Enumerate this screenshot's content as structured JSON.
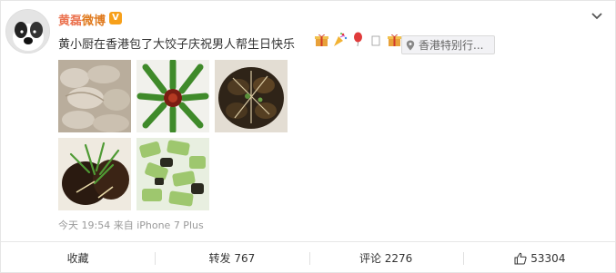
{
  "user": {
    "name_highlight": "黄磊",
    "name_rest": "微博",
    "verified_badge": "V"
  },
  "post": {
    "text": "黄小厨在香港包了大饺子庆祝男人帮生日快乐",
    "emojis": [
      "gift-icon",
      "party-popper-icon",
      "balloon-icon",
      "missing-glyph-icon",
      "gift-icon"
    ],
    "location": "香港特别行..."
  },
  "meta": {
    "time_source": "今天 19:54 来自 iPhone 7 Plus"
  },
  "actions": {
    "favorite": "收藏",
    "repost": "转发 767",
    "comment": "评论 2276",
    "like": "53304"
  },
  "colors": {
    "name_highlight": "#eb7350",
    "name_rest": "#e07a1e",
    "badge": "#f7a01a",
    "meta": "#999999"
  }
}
